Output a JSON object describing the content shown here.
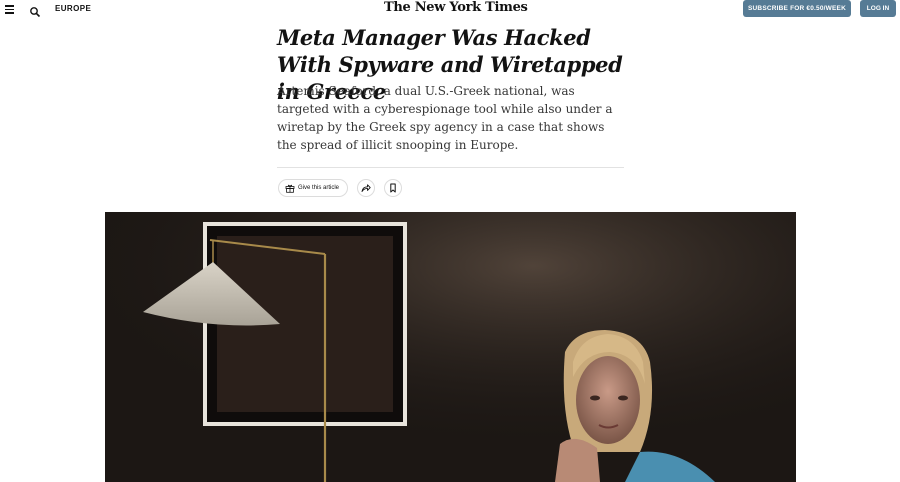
{
  "header": {
    "section": "EUROPE",
    "masthead": "The New York Times",
    "subscribe_label": "SUBSCRIBE FOR €0.50/WEEK",
    "login_label": "LOG IN",
    "icons": [
      "menu-icon",
      "search-icon"
    ],
    "accent_color": "#567b95"
  },
  "article": {
    "headline": "Meta Manager Was Hacked With Spyware and Wiretapped in Greece",
    "summary": "Artemis Seaford, a dual U.S.-Greek national, was targeted with a cyberespionage tool while also under a wiretap by the Greek spy agency in a case that shows the spread of illicit snooping in Europe.",
    "gift_label": "Give this article",
    "action_icons": [
      "gift-icon",
      "share-icon",
      "bookmark-icon"
    ]
  }
}
